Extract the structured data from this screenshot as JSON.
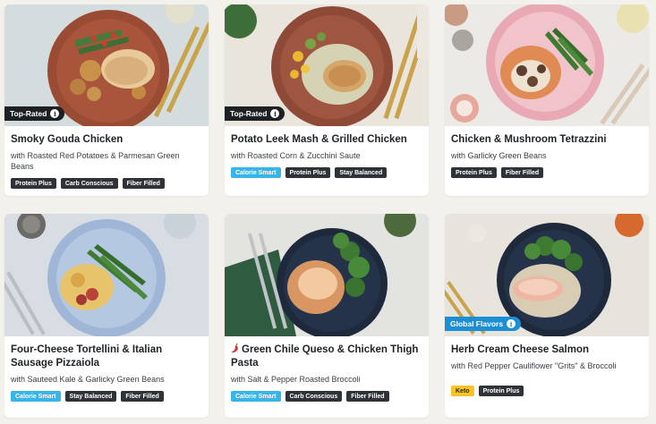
{
  "badge_info_glyph": "i",
  "icons": [
    "info-icon",
    "chili-pepper-icon"
  ],
  "colors": {
    "tag_dark": "#2f3337",
    "tag_calorie_smart": "#37b4e8",
    "tag_keto": "#f7c325",
    "badge_top_rated": "#1e2124",
    "badge_global_flavors": "#1b8fd6"
  },
  "recipes": [
    {
      "badge": "Top-Rated",
      "title": "Smoky Gouda Chicken",
      "subtitle": "with Roasted Red Potatoes & Parmesan Green Beans",
      "tags": [
        "Protein Plus",
        "Carb Conscious",
        "Fiber Filled"
      ]
    },
    {
      "badge": "Top-Rated",
      "title": "Potato Leek Mash & Grilled Chicken",
      "subtitle": "with Roasted Corn & Zucchini Saute",
      "tags": [
        "Calorie Smart",
        "Protein Plus",
        "Stay Balanced"
      ]
    },
    {
      "title": "Chicken & Mushroom Tetrazzini",
      "subtitle": "with Garlicky Green Beans",
      "tags": [
        "Protein Plus",
        "Fiber Filled"
      ]
    },
    {
      "title": "Four-Cheese Tortellini & Italian Sausage Pizzaiola",
      "subtitle": "with Sauteed Kale & Garlicky Green Beans",
      "tags": [
        "Calorie Smart",
        "Stay Balanced",
        "Fiber Filled"
      ]
    },
    {
      "title": "Green Chile Queso & Chicken Thigh Pasta",
      "subtitle": "with Salt & Pepper Roasted Broccoli",
      "tags": [
        "Calorie Smart",
        "Carb Conscious",
        "Fiber Filled"
      ]
    },
    {
      "badge": "Global Flavors",
      "title": "Herb Cream Cheese Salmon",
      "subtitle": "with Red Pepper Cauliflower \"Grits\" & Broccoli",
      "tags": [
        "Keto",
        "Protein Plus"
      ]
    }
  ]
}
